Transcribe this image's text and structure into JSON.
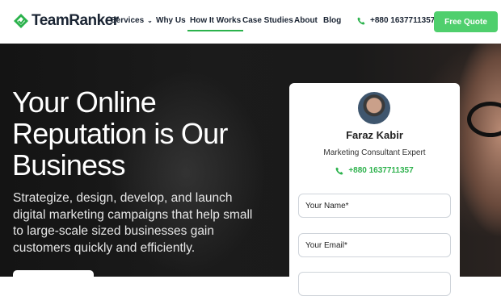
{
  "brand": {
    "name": "TeamRanker",
    "accent": "#2bb24c"
  },
  "nav": {
    "items": [
      {
        "label": "Services",
        "has_dropdown": true
      },
      {
        "label": "Why Us"
      },
      {
        "label": "How It Works",
        "active": true
      },
      {
        "label": "Case Studies"
      },
      {
        "label": "About"
      },
      {
        "label": "Blog"
      }
    ],
    "phone": "+880 1637711357",
    "cta_label": "Free Quote",
    "cta_color": "#4fcf6d"
  },
  "hero": {
    "title": "Your Online Reputation is Our Business",
    "description": "Strategize, design, develop, and launch digital marketing campaigns that help small to large-scale sized businesses gain customers quickly and efficiently."
  },
  "contact_card": {
    "name": "Faraz Kabir",
    "role": "Marketing Consultant Expert",
    "phone": "+880 1637711357",
    "fields": [
      {
        "placeholder": "Your Name*"
      },
      {
        "placeholder": "Your Email*"
      }
    ]
  }
}
